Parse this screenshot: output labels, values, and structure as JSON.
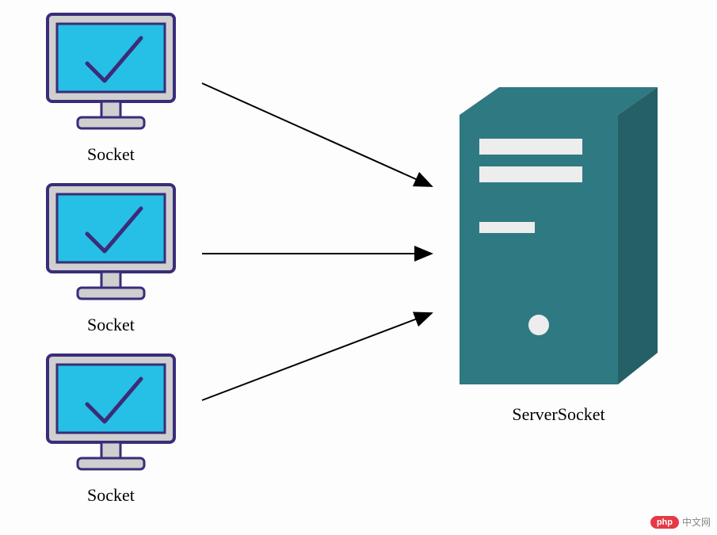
{
  "clients": [
    {
      "label": "Socket"
    },
    {
      "label": "Socket"
    },
    {
      "label": "Socket"
    }
  ],
  "server": {
    "label": "ServerSocket"
  },
  "colors": {
    "monitorFrame": "#3B2C7A",
    "monitorScreen": "#26C0E6",
    "monitorBase": "#CFCFCF",
    "serverBody": "#2F7A82",
    "serverFront": "#286F76",
    "serverSlot": "#EDEDED",
    "arrow": "#000000"
  },
  "watermark": {
    "pill": "php",
    "text": "中文网"
  }
}
